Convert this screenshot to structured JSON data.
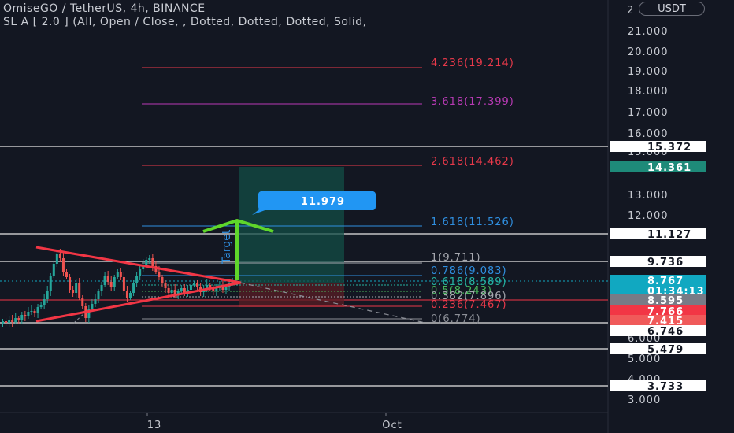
{
  "header": {
    "symbol_line": "OmiseGO / TetherUS, 4h, BINANCE",
    "indicator_line": "SL A [ 2.0 ] (All, Open / Close, , Dotted, Dotted, Dotted, Solid,"
  },
  "unit_label": "USDT",
  "price_axis": {
    "ticks": [
      "21.000",
      "20.000",
      "19.000",
      "18.000",
      "17.000",
      "16.000",
      "15.000",
      "13.000",
      "12.000",
      "6.000",
      "5.000",
      "4.000",
      "3.000"
    ],
    "top_partial": "2"
  },
  "time_axis": {
    "labels": [
      "13",
      "Oct"
    ]
  },
  "fib_levels": [
    {
      "label": "4.236(19.214)",
      "color": "#e8394a"
    },
    {
      "label": "3.618(17.399)",
      "color": "#b83ab5"
    },
    {
      "label": "2.618(14.462)",
      "color": "#e8394a"
    },
    {
      "label": "1.618(11.526)",
      "color": "#2f8fe0"
    },
    {
      "label": "1(9.711)",
      "color": "#a7a9b0"
    },
    {
      "label": "0.786(9.083)",
      "color": "#2f8fe0"
    },
    {
      "label": "0.618(8.589)",
      "color": "#26b3a1"
    },
    {
      "label": "0.5(8.243)",
      "color": "#48b85a"
    },
    {
      "label": "0.382(7.896)",
      "color": "#a7a9b0"
    },
    {
      "label": "0.236(7.467)",
      "color": "#e8394a"
    },
    {
      "label": "0(6.774)",
      "color": "#8c8f97"
    }
  ],
  "price_badges": [
    {
      "text": "15.372",
      "bg": "#ffffff",
      "fg": "#131722"
    },
    {
      "text": "14.361",
      "bg": "#1e8a79",
      "fg": "#ffffff"
    },
    {
      "text": "11.127",
      "bg": "#ffffff",
      "fg": "#131722"
    },
    {
      "text": "9.736",
      "bg": "#ffffff",
      "fg": "#131722"
    },
    {
      "text": "8.767",
      "bg": "#11a8c1",
      "fg": "#ffffff"
    },
    {
      "text": "01:34:13",
      "bg": "#11a8c1",
      "fg": "#ffffff"
    },
    {
      "text": "8.595",
      "bg": "#787b86",
      "fg": "#ffffff"
    },
    {
      "text": "7.766",
      "bg": "#f23645",
      "fg": "#ffffff"
    },
    {
      "text": "7.415",
      "bg": "#f05a5a",
      "fg": "#ffffff"
    },
    {
      "text": "6.746",
      "bg": "#ffffff",
      "fg": "#131722"
    },
    {
      "text": "5.479",
      "bg": "#ffffff",
      "fg": "#131722"
    },
    {
      "text": "3.733",
      "bg": "#ffffff",
      "fg": "#131722"
    }
  ],
  "target_label": "Target",
  "target_callout": "11.979"
}
